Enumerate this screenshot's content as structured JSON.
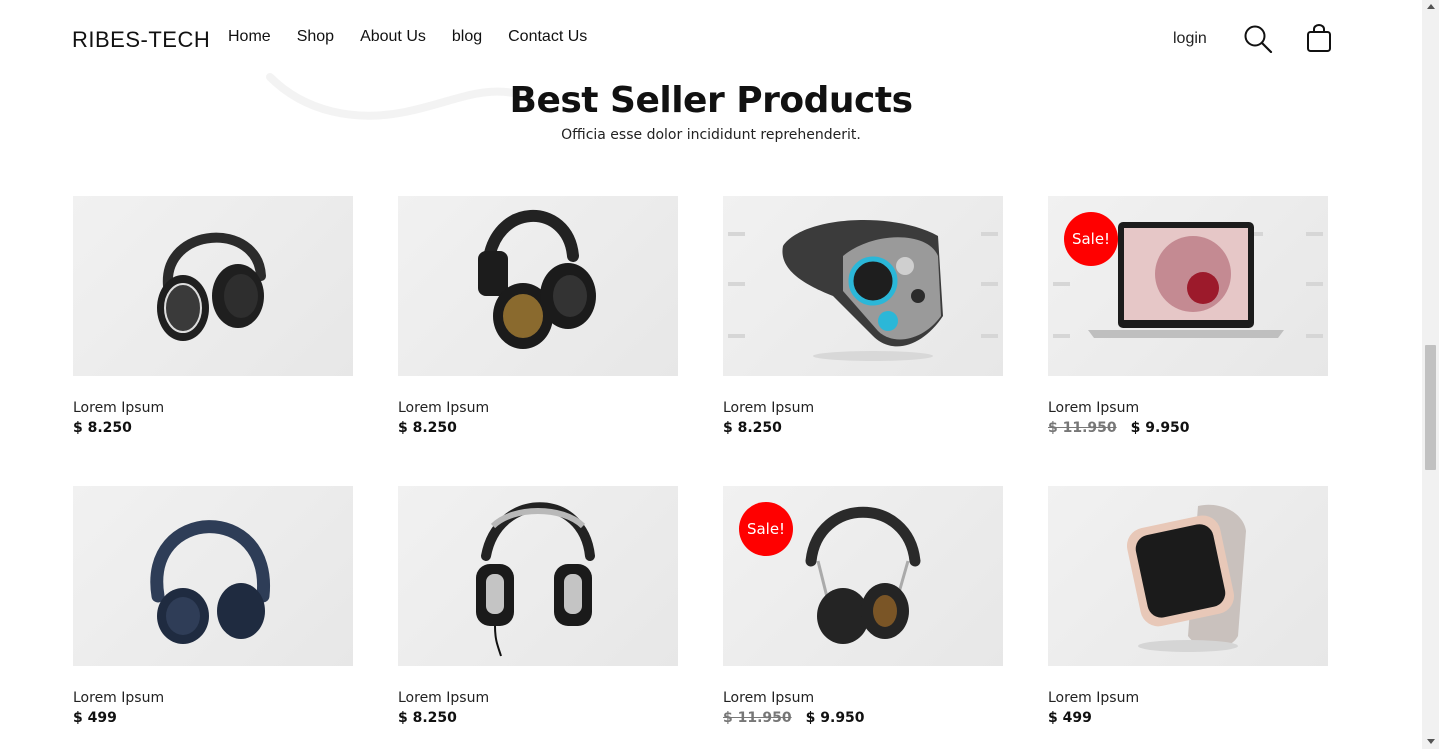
{
  "header": {
    "brand": "RIBES-TECH",
    "nav": [
      "Home",
      "Shop",
      "About Us",
      "blog",
      "Contact Us"
    ],
    "login": "login",
    "search_icon": "search-icon",
    "cart_icon": "shopping-bag-icon"
  },
  "section": {
    "title": "Best Seller Products",
    "subtitle": "Officia esse dolor incididunt reprehenderit."
  },
  "products": [
    {
      "name": "Lorem Ipsum",
      "price": "$ 8.250",
      "old_price": "",
      "sale": "",
      "image": "headphones-black-silver"
    },
    {
      "name": "Lorem Ipsum",
      "price": "$ 8.250",
      "old_price": "",
      "sale": "",
      "image": "headphones-black-gold"
    },
    {
      "name": "Lorem Ipsum",
      "price": "$ 8.250",
      "old_price": "",
      "sale": "",
      "image": "vr-headset"
    },
    {
      "name": "Lorem Ipsum",
      "price": "$ 9.950",
      "old_price": "$ 11.950",
      "sale": "Sale!",
      "image": "laptop"
    },
    {
      "name": "Lorem Ipsum",
      "price": "$ 499",
      "old_price": "",
      "sale": "",
      "image": "headphones-navy"
    },
    {
      "name": "Lorem Ipsum",
      "price": "$ 8.250",
      "old_price": "",
      "sale": "",
      "image": "headphones-studio"
    },
    {
      "name": "Lorem Ipsum",
      "price": "$ 9.950",
      "old_price": "$ 11.950",
      "sale": "Sale!",
      "image": "headphones-brown"
    },
    {
      "name": "Lorem Ipsum",
      "price": "$ 499",
      "old_price": "",
      "sale": "",
      "image": "smartwatch"
    }
  ],
  "colors": {
    "sale_badge": "#ff0000",
    "thumb_bg": "#ececec",
    "text": "#111111"
  }
}
